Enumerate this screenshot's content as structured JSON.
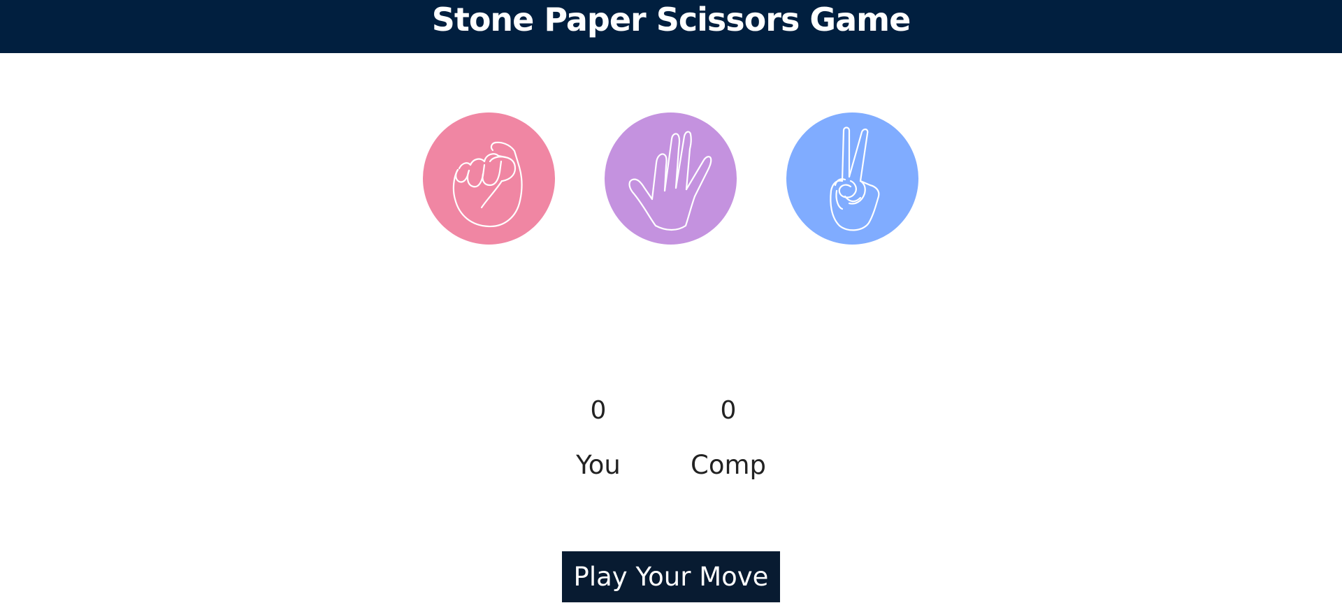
{
  "header": {
    "title": "Stone Paper Scissors Game"
  },
  "choices": [
    {
      "id": "stone",
      "icon": "fist-icon",
      "color": "#f086a3"
    },
    {
      "id": "paper",
      "icon": "open-hand-icon",
      "color": "#c492df"
    },
    {
      "id": "scissors",
      "icon": "peace-hand-icon",
      "color": "#80acff"
    }
  ],
  "scoreboard": {
    "user_score": "0",
    "user_label": "You",
    "comp_score": "0",
    "comp_label": "Comp"
  },
  "message": {
    "label": "Play Your Move",
    "background": "#081b31"
  },
  "colors": {
    "header_bg": "#011f3f",
    "text": "#222222"
  }
}
